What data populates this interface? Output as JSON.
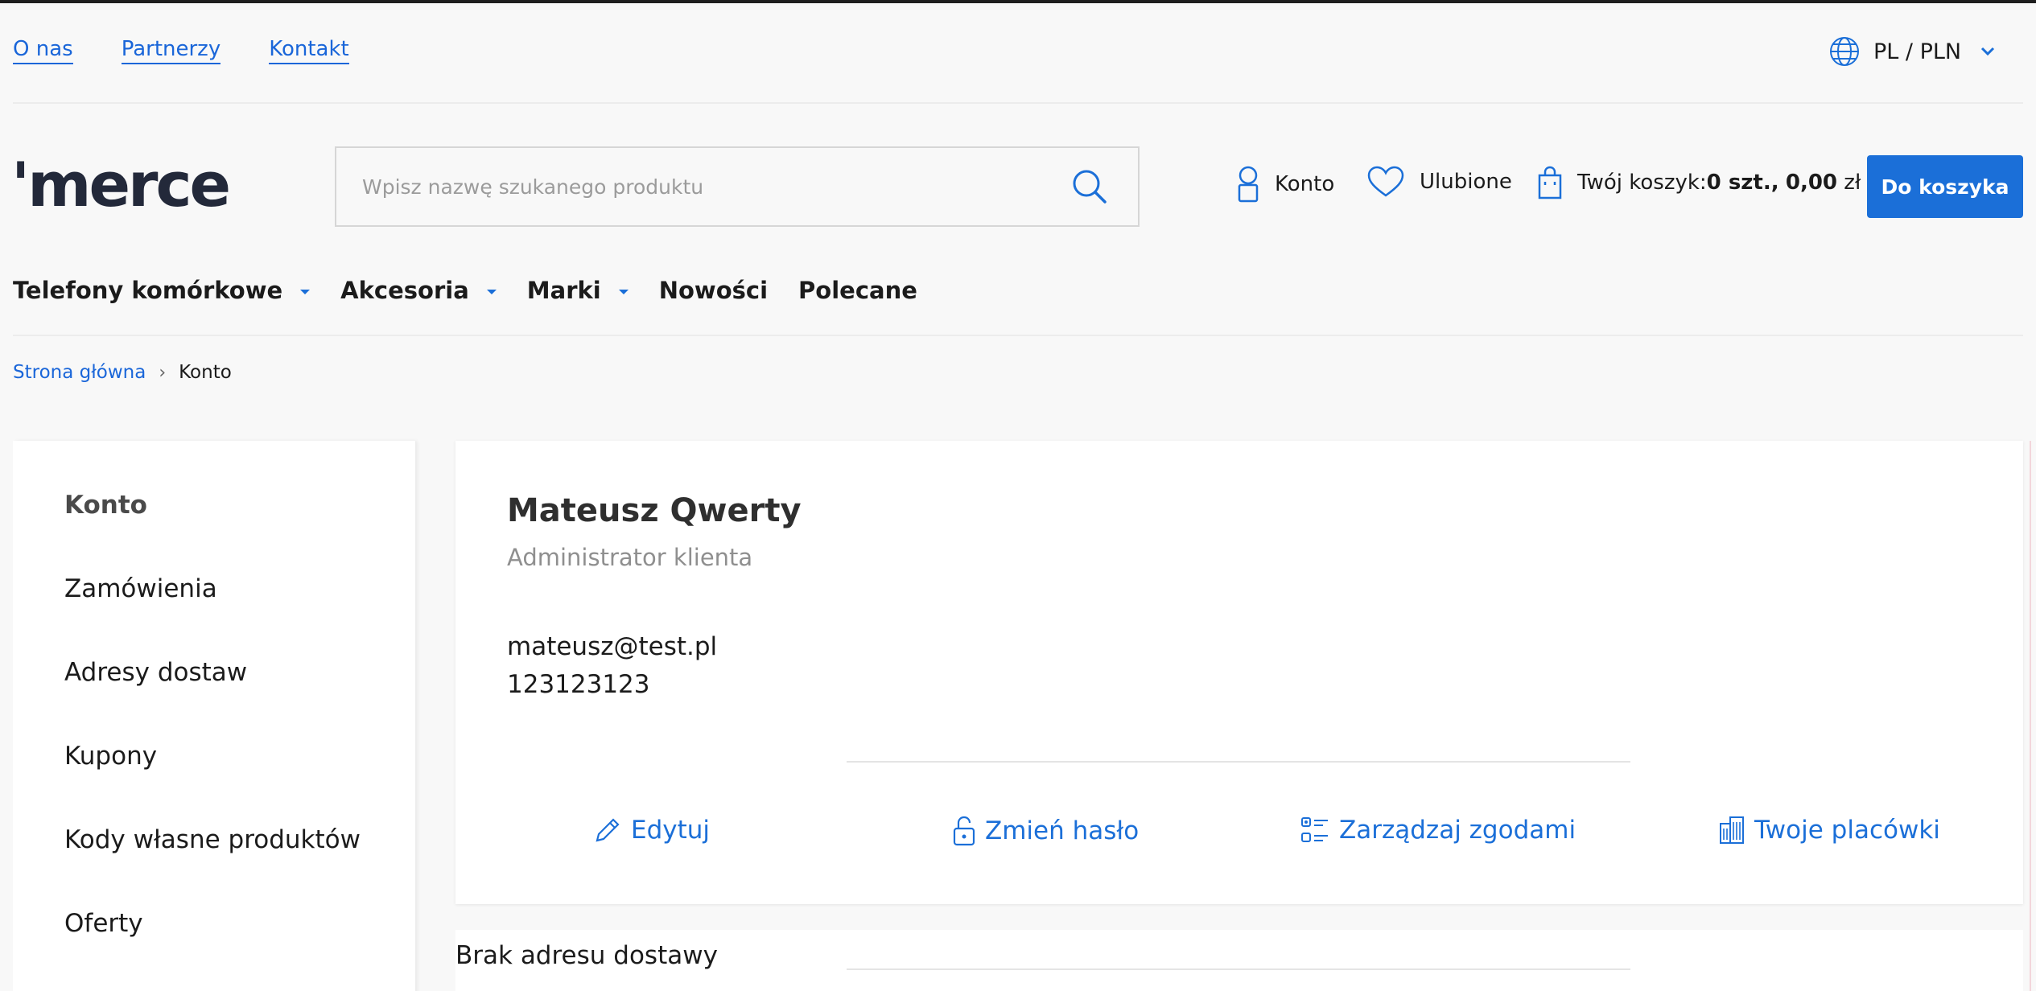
{
  "topbar": {
    "links": [
      "O nas",
      "Partnerzy",
      "Kontakt"
    ],
    "lang_currency": "PL / PLN"
  },
  "header": {
    "logo_text": "'merce",
    "search_placeholder": "Wpisz nazwę szukanego produktu",
    "account_label": "Konto",
    "favorites_label": "Ulubione",
    "cart_prefix": "Twój koszyk:",
    "cart_count": "0 szt.,",
    "cart_total": "0,00",
    "cart_currency": "zł",
    "cart_button": "Do koszyka"
  },
  "nav": {
    "items": [
      {
        "label": "Telefony komórkowe",
        "dropdown": true
      },
      {
        "label": "Akcesoria",
        "dropdown": true
      },
      {
        "label": "Marki",
        "dropdown": true
      },
      {
        "label": "Nowości",
        "dropdown": false
      },
      {
        "label": "Polecane",
        "dropdown": false
      }
    ]
  },
  "breadcrumb": {
    "home": "Strona główna",
    "separator": "›",
    "current": "Konto"
  },
  "sidebar": {
    "items": [
      "Konto",
      "Zamówienia",
      "Adresy dostaw",
      "Kupony",
      "Kody własne produktów",
      "Oferty"
    ],
    "active": "Konto"
  },
  "profile": {
    "name": "Mateusz Qwerty",
    "role": "Administrator klienta",
    "email": "mateusz@test.pl",
    "phone": "123123123"
  },
  "actions": {
    "edit": "Edytuj",
    "change_password": "Zmień hasło",
    "manage_consents": "Zarządzaj zgodami",
    "locations": "Twoje placówki"
  },
  "delivery": {
    "no_address": "Brak adresu dostawy"
  },
  "colors": {
    "accent": "#1b6fd8",
    "link": "#1a66d9",
    "logo": "#23293a",
    "muted": "#8f8f8f"
  },
  "icons": {
    "lang": "globe-icon",
    "search": "search-icon",
    "account": "user-icon",
    "favorites": "heart-icon",
    "cart": "shopping-bag-icon",
    "edit": "pencil-icon",
    "password": "lock-icon",
    "consents": "checklist-icon",
    "locations": "building-icon"
  }
}
